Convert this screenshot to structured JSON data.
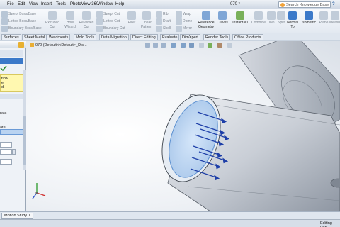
{
  "window": {
    "menus": [
      "File",
      "Edit",
      "View",
      "Insert",
      "Tools",
      "PhotoView 360",
      "Window",
      "Help"
    ],
    "document_title": "070 *",
    "search_placeholder": "Search Knowledge Base",
    "help_symbol": "?"
  },
  "ribbon": {
    "col1": [
      "Swept Boss/Base",
      "Lofted Boss/Base",
      "Boundary Boss/Base"
    ],
    "big1": [
      "Extruded",
      "Cut"
    ],
    "big2": [
      "Hole",
      "Wizard"
    ],
    "big3": [
      "Revolved",
      "Cut"
    ],
    "col2": [
      "Swept Cut",
      "Lofted Cut",
      "Boundary Cut"
    ],
    "big4": [
      "Fillet"
    ],
    "big5": [
      "Linear",
      "Pattern"
    ],
    "col3": [
      "Rib",
      "Draft",
      "Shell"
    ],
    "col4": [
      "Wrap",
      "Dome",
      "Mirror"
    ],
    "big6": [
      "Reference",
      "Geometry"
    ],
    "big7": [
      "Curves"
    ],
    "big8": [
      "Instant3D"
    ],
    "big9": [
      "Combine"
    ],
    "big10": [
      "Join"
    ],
    "big11": [
      "Split"
    ],
    "big12": [
      "Normal",
      "To"
    ],
    "big13": [
      "Isometric"
    ],
    "big14": [
      "Plane"
    ],
    "big15": [
      "Measu"
    ]
  },
  "tabs": [
    "Surfaces",
    "Sheet Metal",
    "Weldments",
    "Mold Tools",
    "Data Migration",
    "Direct Editing",
    "Evaluate",
    "DimXpert",
    "Render Tools",
    "Office Products"
  ],
  "left_panel": {
    "message_lines": [
      "flow",
      "e",
      "d."
    ],
    "rate_label": "rate",
    "rate_label2": "ate"
  },
  "viewport": {
    "tree_flyout": "070  (Default<<Default>_Dis..."
  },
  "bottom": {
    "motion_tab": "Motion Study 1",
    "status": "Editing Part"
  },
  "colors": {
    "accent": "#3b79c9",
    "arrow": "#1e3fa8",
    "message_bg": "#fff8b0"
  }
}
